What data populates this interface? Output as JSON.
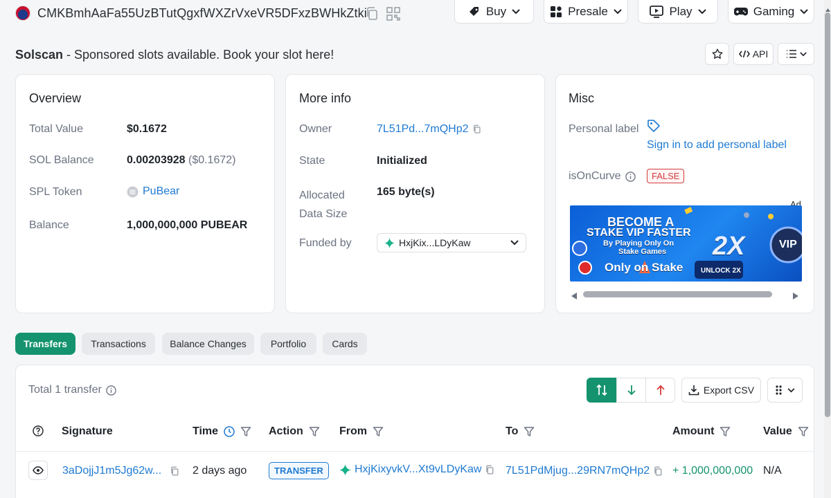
{
  "header": {
    "address": "CMKBmhAaFa55UzBTutQgxfWXZrVxeVR5DFxzBWHkZtki",
    "nav": [
      {
        "label": "Buy",
        "icon": "tag-icon"
      },
      {
        "label": "Presale",
        "icon": "grid-icon"
      },
      {
        "label": "Play",
        "icon": "play-icon"
      },
      {
        "label": "Gaming",
        "icon": "gamepad-icon"
      }
    ]
  },
  "sponsor": {
    "brand": "Solscan",
    "text": " - Sponsored slots available. Book your slot here!"
  },
  "actions": {
    "api_label": "API"
  },
  "overview": {
    "title": "Overview",
    "total_value_label": "Total Value",
    "total_value": "$0.1672",
    "sol_balance_label": "SOL Balance",
    "sol_balance": "0.00203928",
    "sol_balance_usd": "($0.1672)",
    "spl_token_label": "SPL Token",
    "spl_token": "PuBear",
    "balance_label": "Balance",
    "balance": "1,000,000,000 PUBEAR"
  },
  "more_info": {
    "title": "More info",
    "owner_label": "Owner",
    "owner": "7L51Pd...7mQHp2",
    "state_label": "State",
    "state": "Initialized",
    "allocated_label_1": "Allocated",
    "allocated_label_2": "Data Size",
    "allocated": "165 byte(s)",
    "funded_label": "Funded by",
    "funded": "HxjKix...LDyKaw"
  },
  "misc": {
    "title": "Misc",
    "personal_label": "Personal label",
    "sign_in": "Sign in to add personal label",
    "oncurve_label": "isOnCurve",
    "oncurve": "FALSE",
    "ad_tag": "Ad",
    "ad": {
      "line1": "BECOME A",
      "line2": "STAKE VIP FASTER",
      "line3": "By Playing Only On",
      "line4": "Stake Games",
      "line5": "Only on Stake",
      "badge": "2X",
      "vip": "VIP",
      "cta": "UNLOCK 2X"
    }
  },
  "tabs": [
    "Transfers",
    "Transactions",
    "Balance Changes",
    "Portfolio",
    "Cards"
  ],
  "transfers": {
    "total": "Total 1 transfer",
    "export": "Export CSV",
    "columns": [
      "Signature",
      "Time",
      "Action",
      "From",
      "To",
      "Amount",
      "Value"
    ],
    "rows": [
      {
        "signature": "3aDojjJ1m5Jg62w...",
        "time": "2 days ago",
        "action": "TRANSFER",
        "from": "HxjKixyvkV...Xt9vLDyKaw",
        "to": "7L51PdMjug...29RN7mQHp2",
        "amount": "+ 1,000,000,000",
        "value": "N/A"
      }
    ]
  },
  "colors": {
    "accent": "#14936e",
    "link": "#1f7ad1",
    "danger": "#d43a3a"
  }
}
